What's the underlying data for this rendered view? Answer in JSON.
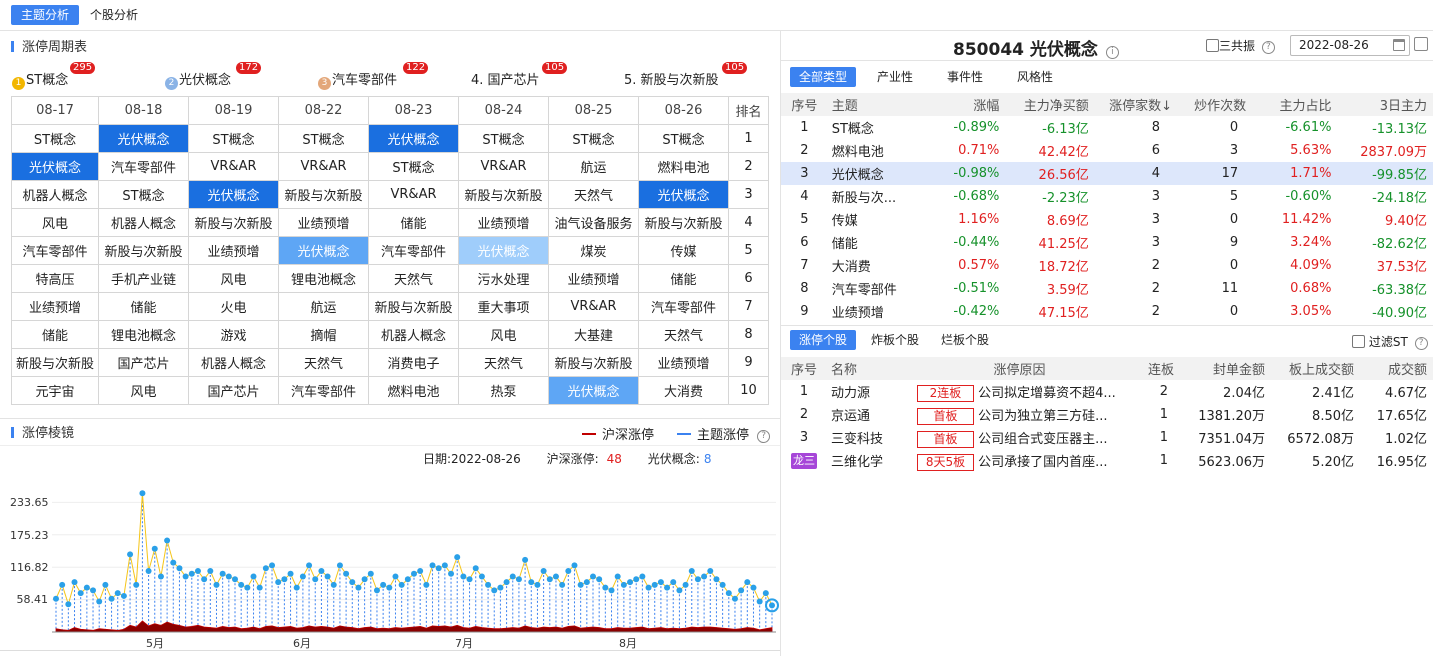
{
  "top_tabs": [
    "主题分析",
    "个股分析"
  ],
  "cycle": {
    "title": "涨停周期表",
    "stats": [
      {
        "prefix": "",
        "medal": "1",
        "medal_color": "#f2b600",
        "label": "ST概念",
        "count": "295"
      },
      {
        "prefix": "",
        "medal": "2",
        "medal_color": "#8ab3e6",
        "label": "光伏概念",
        "count": "172"
      },
      {
        "prefix": "",
        "medal": "3",
        "medal_color": "#e3a77a",
        "label": "汽车零部件",
        "count": "122"
      },
      {
        "prefix": "4.",
        "medal": "",
        "medal_color": "",
        "label": "国产芯片",
        "count": "105"
      },
      {
        "prefix": "5.",
        "medal": "",
        "medal_color": "",
        "label": "新股与次新股",
        "count": "105"
      }
    ],
    "headers": [
      "08-17",
      "08-18",
      "08-19",
      "08-22",
      "08-23",
      "08-24",
      "08-25",
      "08-26",
      "排名"
    ],
    "rows": [
      [
        "ST概念",
        "光伏概念",
        "ST概念",
        "ST概念",
        "光伏概念",
        "ST概念",
        "ST概念",
        "ST概念",
        "1"
      ],
      [
        "光伏概念",
        "汽车零部件",
        "VR&AR",
        "VR&AR",
        "ST概念",
        "VR&AR",
        "航运",
        "燃料电池",
        "2"
      ],
      [
        "机器人概念",
        "ST概念",
        "光伏概念",
        "新股与次新股",
        "VR&AR",
        "新股与次新股",
        "天然气",
        "光伏概念",
        "3"
      ],
      [
        "风电",
        "机器人概念",
        "新股与次新股",
        "业绩预增",
        "储能",
        "业绩预增",
        "油气设备服务",
        "新股与次新股",
        "4"
      ],
      [
        "汽车零部件",
        "新股与次新股",
        "业绩预增",
        "光伏概念",
        "汽车零部件",
        "光伏概念",
        "煤炭",
        "传媒",
        "5"
      ],
      [
        "特高压",
        "手机产业链",
        "风电",
        "锂电池概念",
        "天然气",
        "污水处理",
        "业绩预增",
        "储能",
        "6"
      ],
      [
        "业绩预增",
        "储能",
        "火电",
        "航运",
        "新股与次新股",
        "重大事项",
        "VR&AR",
        "汽车零部件",
        "7"
      ],
      [
        "储能",
        "锂电池概念",
        "游戏",
        "摘帽",
        "机器人概念",
        "风电",
        "大基建",
        "天然气",
        "8"
      ],
      [
        "新股与次新股",
        "国产芯片",
        "机器人概念",
        "天然气",
        "消费电子",
        "天然气",
        "新股与次新股",
        "业绩预增",
        "9"
      ],
      [
        "元宇宙",
        "风电",
        "国产芯片",
        "汽车零部件",
        "燃料电池",
        "热泵",
        "光伏概念",
        "大消费",
        "10"
      ]
    ]
  },
  "mirror": {
    "title": "涨停棱镜",
    "legend_a": "沪深涨停",
    "legend_b": "主题涨停",
    "date_label": "日期:",
    "date": "2022-08-26",
    "total_label": "沪深涨停:",
    "total": "48",
    "theme_label": "光伏概念:",
    "theme": "8"
  },
  "chart_data": {
    "type": "line",
    "yticks": [
      "233.65",
      "175.23",
      "116.82",
      "58.41"
    ],
    "ylim": [
      0,
      292
    ],
    "months": [
      "5月",
      "6月",
      "7月",
      "8月"
    ],
    "series": [
      {
        "name": "沪深涨停",
        "values": [
          60,
          85,
          50,
          90,
          70,
          80,
          75,
          55,
          85,
          60,
          70,
          65,
          140,
          85,
          250,
          110,
          150,
          100,
          165,
          125,
          115,
          100,
          105,
          110,
          95,
          110,
          85,
          105,
          100,
          95,
          85,
          80,
          100,
          80,
          115,
          120,
          90,
          95,
          105,
          80,
          100,
          120,
          95,
          110,
          100,
          85,
          120,
          105,
          90,
          80,
          95,
          105,
          75,
          85,
          80,
          100,
          85,
          95,
          105,
          110,
          85,
          120,
          115,
          120,
          105,
          135,
          100,
          95,
          115,
          100,
          85,
          75,
          80,
          90,
          100,
          95,
          130,
          90,
          85,
          110,
          95,
          100,
          85,
          110,
          120,
          85,
          90,
          100,
          95,
          80,
          75,
          100,
          85,
          90,
          95,
          100,
          80,
          85,
          90,
          80,
          90,
          75,
          85,
          110,
          95,
          100,
          110,
          95,
          85,
          70,
          60,
          75,
          90,
          80,
          55,
          70,
          48
        ]
      },
      {
        "name": "主题涨停",
        "values": [
          6,
          4,
          3,
          8,
          5,
          4,
          3,
          6,
          5,
          4,
          3,
          5,
          12,
          9,
          20,
          11,
          15,
          12,
          18,
          14,
          12,
          9,
          10,
          12,
          9,
          8,
          7,
          10,
          8,
          9,
          6,
          7,
          9,
          6,
          10,
          11,
          8,
          9,
          10,
          7,
          8,
          11,
          9,
          10,
          9,
          7,
          11,
          9,
          8,
          6,
          8,
          9,
          6,
          7,
          6,
          8,
          7,
          8,
          9,
          10,
          7,
          11,
          10,
          11,
          9,
          12,
          8,
          7,
          10,
          8,
          7,
          6,
          6,
          7,
          8,
          7,
          11,
          8,
          7,
          9,
          8,
          9,
          7,
          10,
          11,
          7,
          8,
          9,
          8,
          6,
          6,
          8,
          7,
          7,
          8,
          9,
          6,
          7,
          8,
          6,
          7,
          6,
          7,
          9,
          8,
          9,
          9,
          8,
          7,
          6,
          5,
          6,
          8,
          7,
          4,
          6,
          8
        ]
      }
    ]
  },
  "detail": {
    "code": "850044",
    "name": "光伏概念",
    "resonance_label": "三共振",
    "date": "2022-08-26",
    "filter_tabs": [
      "全部类型",
      "产业性",
      "事件性",
      "风格性"
    ],
    "columns": [
      "序号",
      "主题",
      "涨幅",
      "主力净买额",
      "涨停家数↓",
      "炒作次数",
      "主力占比",
      "3日主力"
    ],
    "rows": [
      {
        "no": "1",
        "name": "ST概念",
        "chg": "-0.89%",
        "net": "-6.13亿",
        "lim": "8",
        "hype": "0",
        "ratio": "-6.61%",
        "d3": "-13.13亿"
      },
      {
        "no": "2",
        "name": "燃料电池",
        "chg": "0.71%",
        "net": "42.42亿",
        "lim": "6",
        "hype": "3",
        "ratio": "5.63%",
        "d3": "2837.09万"
      },
      {
        "no": "3",
        "name": "光伏概念",
        "chg": "-0.98%",
        "net": "26.56亿",
        "lim": "4",
        "hype": "17",
        "ratio": "1.71%",
        "d3": "-99.85亿"
      },
      {
        "no": "4",
        "name": "新股与次...",
        "chg": "-0.68%",
        "net": "-2.23亿",
        "lim": "3",
        "hype": "5",
        "ratio": "-0.60%",
        "d3": "-24.18亿"
      },
      {
        "no": "5",
        "name": "传媒",
        "chg": "1.16%",
        "net": "8.69亿",
        "lim": "3",
        "hype": "0",
        "ratio": "11.42%",
        "d3": "9.40亿"
      },
      {
        "no": "6",
        "name": "储能",
        "chg": "-0.44%",
        "net": "41.25亿",
        "lim": "3",
        "hype": "9",
        "ratio": "3.24%",
        "d3": "-82.62亿"
      },
      {
        "no": "7",
        "name": "大消费",
        "chg": "0.57%",
        "net": "18.72亿",
        "lim": "2",
        "hype": "0",
        "ratio": "4.09%",
        "d3": "37.53亿"
      },
      {
        "no": "8",
        "name": "汽车零部件",
        "chg": "-0.51%",
        "net": "3.59亿",
        "lim": "2",
        "hype": "11",
        "ratio": "0.68%",
        "d3": "-63.38亿"
      },
      {
        "no": "9",
        "name": "业绩预增",
        "chg": "-0.42%",
        "net": "47.15亿",
        "lim": "2",
        "hype": "0",
        "ratio": "3.05%",
        "d3": "-40.90亿"
      }
    ]
  },
  "stocks": {
    "tabs": [
      "涨停个股",
      "炸板个股",
      "烂板个股"
    ],
    "filter_st": "过滤ST",
    "columns": [
      "序号",
      "名称",
      "涨停原因",
      "连板",
      "封单金额",
      "板上成交额",
      "成交额"
    ],
    "rows": [
      {
        "no": "1",
        "name": "动力源",
        "tag": "2连板",
        "reason": "公司拟定增募资不超4...",
        "lb": "2",
        "seal": "2.04亿",
        "on": "2.41亿",
        "amt": "4.67亿"
      },
      {
        "no": "2",
        "name": "京运通",
        "tag": "首板",
        "reason": "公司为独立第三方硅...",
        "lb": "1",
        "seal": "1381.20万",
        "on": "8.50亿",
        "amt": "17.65亿"
      },
      {
        "no": "3",
        "name": "三变科技",
        "tag": "首板",
        "reason": "公司组合式变压器主...",
        "lb": "1",
        "seal": "7351.04万",
        "on": "6572.08万",
        "amt": "1.02亿"
      },
      {
        "no": "龙三",
        "name": "三维化学",
        "tag": "8天5板",
        "reason": "公司承接了国内首座...",
        "lb": "1",
        "seal": "5623.06万",
        "on": "5.20亿",
        "amt": "16.95亿"
      }
    ]
  }
}
